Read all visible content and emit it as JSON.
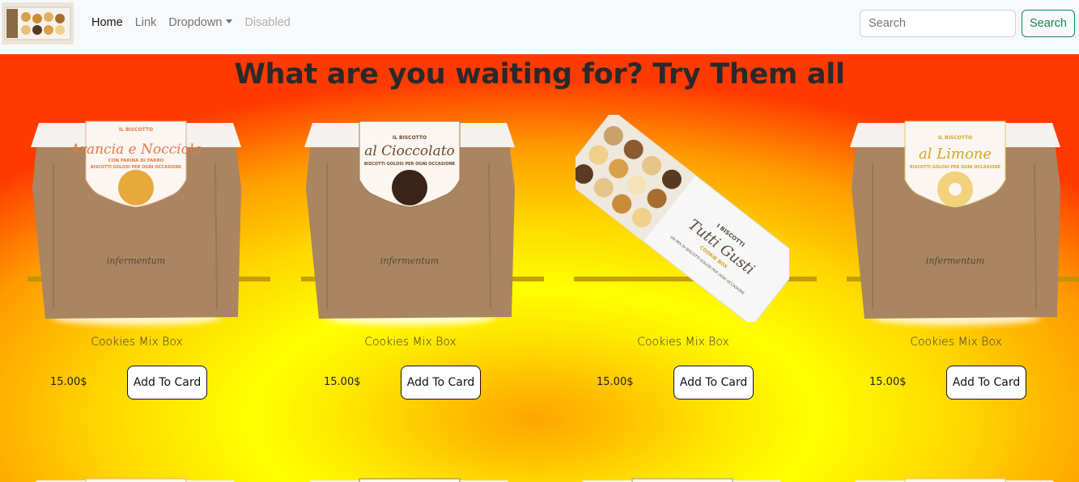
{
  "navbar": {
    "links": [
      {
        "label": "Home",
        "state": "active"
      },
      {
        "label": "Link",
        "state": "normal"
      },
      {
        "label": "Dropdown",
        "state": "dropdown"
      },
      {
        "label": "Disabled",
        "state": "disabled"
      }
    ],
    "search_placeholder": "Search",
    "search_button": "Search"
  },
  "main": {
    "headline": "What are you waiting for? Try Them all"
  },
  "products": [
    {
      "name": "Cookies Mix Box",
      "price": "15.00$",
      "button": "Add To Card",
      "bag_title": "Arancia e Nocciola",
      "bag_label": "IL BISCOTTO",
      "bag_subtitle": "CON FARINA DI FARRO",
      "bag_tagline": "BISCOTTI GOLOSI PER OGNI OCCASIONE",
      "brand": "infermentum",
      "accent": "#e07a4a",
      "cookie": "#e6a93a"
    },
    {
      "name": "Cookies Mix Box",
      "price": "15.00$",
      "button": "Add To Card",
      "bag_title": "al Cioccolato",
      "bag_label": "IL BISCOTTO",
      "bag_subtitle": "",
      "bag_tagline": "BISCOTTI GOLOSI PER OGNI OCCASIONE",
      "brand": "infermentum",
      "accent": "#6b4a2b",
      "cookie": "#3a2418"
    },
    {
      "name": "Cookies Mix Box",
      "price": "15.00$",
      "button": "Add To Card",
      "bag_title": "Tutti Gusti",
      "bag_label": "I BISCOTTI",
      "bag_subtitle": "COOKIE BOX",
      "bag_tagline": "UN MIX DI BISCOTTI GOLOSI PER OGNI OCCASIONE",
      "brand": "infermentum",
      "accent": "#5a4a3a",
      "cookie": "#c9a46a"
    },
    {
      "name": "Cookies Mix Box",
      "price": "15.00$",
      "button": "Add To Card",
      "bag_title": "al Limone",
      "bag_label": "IL BISCOTTO",
      "bag_subtitle": "",
      "bag_tagline": "BISCOTTI GOLOSI PER OGNI OCCASIONE",
      "brand": "infermentum",
      "accent": "#d4a62a",
      "cookie": "#f2d27a"
    }
  ]
}
